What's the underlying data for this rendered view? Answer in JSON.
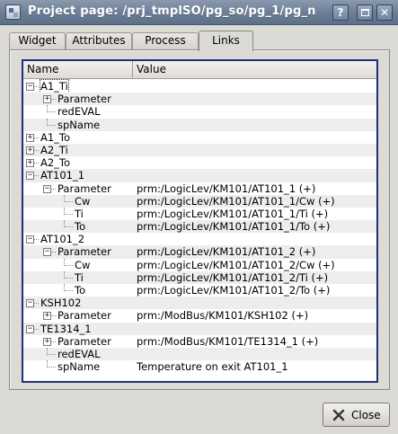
{
  "window": {
    "title": "Project page: /prj_tmplSO/pg_so/pg_1/pg_n",
    "help_label": "?",
    "close_label": "✕"
  },
  "tabs": [
    {
      "label": "Widget"
    },
    {
      "label": "Attributes"
    },
    {
      "label": "Process"
    },
    {
      "label": "Links"
    }
  ],
  "active_tab": "Links",
  "tree": {
    "columns": [
      "Name",
      "Value"
    ],
    "rows": [
      {
        "name": "A1_Ti",
        "value": ""
      },
      {
        "name": "Parameter",
        "value": ""
      },
      {
        "name": "redEVAL",
        "value": ""
      },
      {
        "name": "spName",
        "value": ""
      },
      {
        "name": "A1_To",
        "value": ""
      },
      {
        "name": "A2_Ti",
        "value": ""
      },
      {
        "name": "A2_To",
        "value": ""
      },
      {
        "name": "AT101_1",
        "value": ""
      },
      {
        "name": "Parameter",
        "value": "prm:/LogicLev/KM101/AT101_1 (+)"
      },
      {
        "name": "Cw",
        "value": "prm:/LogicLev/KM101/AT101_1/Cw (+)"
      },
      {
        "name": "Ti",
        "value": "prm:/LogicLev/KM101/AT101_1/Ti (+)"
      },
      {
        "name": "To",
        "value": "prm:/LogicLev/KM101/AT101_1/To (+)"
      },
      {
        "name": "AT101_2",
        "value": ""
      },
      {
        "name": "Parameter",
        "value": "prm:/LogicLev/KM101/AT101_2 (+)"
      },
      {
        "name": "Cw",
        "value": "prm:/LogicLev/KM101/AT101_2/Cw (+)"
      },
      {
        "name": "Ti",
        "value": "prm:/LogicLev/KM101/AT101_2/Ti (+)"
      },
      {
        "name": "To",
        "value": "prm:/LogicLev/KM101/AT101_2/To (+)"
      },
      {
        "name": "KSH102",
        "value": ""
      },
      {
        "name": "Parameter",
        "value": "prm:/ModBus/KM101/KSH102 (+)"
      },
      {
        "name": "TE1314_1",
        "value": ""
      },
      {
        "name": "Parameter",
        "value": "prm:/ModBus/KM101/TE1314_1 (+)"
      },
      {
        "name": "redEVAL",
        "value": ""
      },
      {
        "name": "spName",
        "value": "Temperature on exit AT101_1"
      }
    ]
  },
  "buttons": {
    "close_label": "Close"
  },
  "icons": {
    "window": "window-icon",
    "close_button": "x-close-icon",
    "expanded": "minus-box",
    "collapsed": "plus-box"
  }
}
